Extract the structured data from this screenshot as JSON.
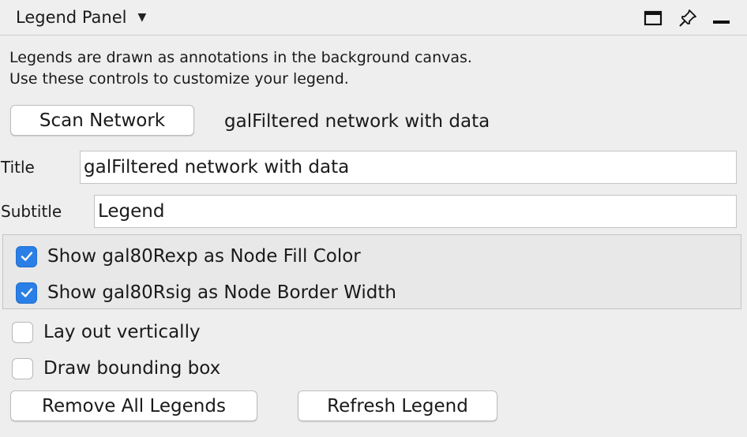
{
  "header": {
    "title": "Legend Panel",
    "dropdown_icon": "chevron-down-icon",
    "icons": [
      "maximize-icon",
      "pin-icon",
      "minimize-icon"
    ]
  },
  "description": {
    "line1": "Legends are drawn as annotations in the background canvas.",
    "line2": "Use these controls to customize your legend."
  },
  "scan": {
    "button_label": "Scan Network",
    "network_name": "galFiltered network with data"
  },
  "fields": {
    "title_label": "Title",
    "title_value": "galFiltered network with data",
    "subtitle_label": "Subtitle",
    "subtitle_value": "Legend"
  },
  "mappings": [
    {
      "label": "Show gal80Rexp as Node Fill Color",
      "checked": true
    },
    {
      "label": "Show gal80Rsig as Node Border Width",
      "checked": true
    }
  ],
  "options": [
    {
      "label": "Lay out vertically",
      "checked": false
    },
    {
      "label": "Draw bounding box",
      "checked": false
    }
  ],
  "actions": {
    "remove_label": "Remove All Legends",
    "refresh_label": "Refresh Legend"
  },
  "colors": {
    "accent": "#2a7fe6",
    "background": "#eeeeee"
  }
}
